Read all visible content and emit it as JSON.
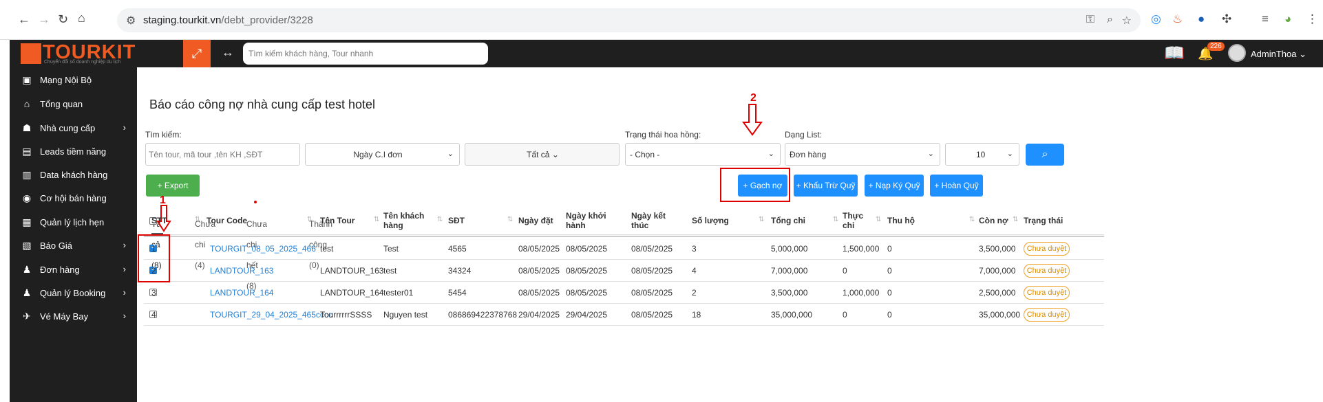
{
  "browser": {
    "url_host": "staging.tourkit.vn",
    "url_path": "/debt_provider/3228"
  },
  "topbar": {
    "logo": "TOURKIT",
    "logo_tagline": "Chuyển đổi số doanh nghiệp du lịch",
    "search_placeholder": "Tìm kiếm khách hàng, Tour nhanh",
    "notification_count": "226",
    "user_name": "AdminThoa ⌄"
  },
  "sidebar": {
    "items": [
      {
        "label": "Mạng Nội Bộ",
        "icon": "briefcase-icon",
        "glyph": "▣",
        "chev": ""
      },
      {
        "label": "Tổng quan",
        "icon": "home-icon",
        "glyph": "⌂",
        "chev": ""
      },
      {
        "label": "Nhà cung cấp",
        "icon": "users-icon",
        "glyph": "☗",
        "chev": "›"
      },
      {
        "label": "Leads tiềm năng",
        "icon": "files-icon",
        "glyph": "▤",
        "chev": ""
      },
      {
        "label": "Data khách hàng",
        "icon": "database-icon",
        "glyph": "▥",
        "chev": ""
      },
      {
        "label": "Cơ hội bán hàng",
        "icon": "target-icon",
        "glyph": "◉",
        "chev": ""
      },
      {
        "label": "Quản lý lịch hẹn",
        "icon": "calendar-icon",
        "glyph": "▦",
        "chev": ""
      },
      {
        "label": "Báo Giá",
        "icon": "quote-icon",
        "glyph": "▧",
        "chev": "›"
      },
      {
        "label": "Đơn hàng",
        "icon": "order-icon",
        "glyph": "♟",
        "chev": "›"
      },
      {
        "label": "Quản lý Booking",
        "icon": "booking-icon",
        "glyph": "♟",
        "chev": "›"
      },
      {
        "label": "Vé Máy Bay",
        "icon": "plane-icon",
        "glyph": "✈",
        "chev": "›"
      }
    ]
  },
  "page": {
    "title": "Báo cáo công nợ nhà cung cấp test hotel"
  },
  "filters": {
    "search_label": "Tìm kiếm:",
    "search_placeholder": "Tên tour, mã tour ,tên KH ,SĐT",
    "date_type": "Ngày C.I đơn",
    "all": "Tất cả",
    "commission_label": "Trạng thái hoa hồng:",
    "commission_value": "- Chọn -",
    "list_type_label": "Dạng List:",
    "list_type_value": "Đơn hàng",
    "page_size": "10"
  },
  "actions": {
    "export": "Export",
    "gach_no": "Gạch nợ",
    "khau_tru_quy": "Khấu Trừ Quỹ",
    "nap_ky_quy": "Nạp Ký Quỹ",
    "hoan_quy": "Hoàn Quỹ"
  },
  "tabs": [
    "Tất cả (8)",
    "Chưa chi (4)",
    "Chưa chi hết (8)",
    "Thành công (0)"
  ],
  "table": {
    "headers": {
      "stt": "STT",
      "tour_code": "Tour Code",
      "ten_tour": "Tên Tour",
      "ten_kh_1": "Tên khách",
      "ten_kh_2": "hàng",
      "sdt": "SĐT",
      "ngay_dat": "Ngày đặt",
      "ngay_khoi_1": "Ngày khởi",
      "ngay_khoi_2": "hành",
      "ngay_ket_1": "Ngày kết",
      "ngay_ket_2": "thúc",
      "so_luong": "Số lượng",
      "tong_chi": "Tổng chi",
      "thuc_chi_1": "Thực",
      "thuc_chi_2": "chi",
      "thu_ho": "Thu hộ",
      "con_no": "Còn nợ",
      "trang_thai": "Trạng thái"
    },
    "rows": [
      {
        "checked": true,
        "stt": "1",
        "tour_code": "TOURGIT_08_05_2025_466",
        "ten_tour": "test",
        "ten_kh": "Test",
        "sdt": "4565",
        "ngay_dat": "08/05/2025",
        "ngay_khoi": "08/05/2025",
        "ngay_ket": "08/05/2025",
        "so_luong": "3",
        "tong_chi": "5,000,000",
        "thuc_chi": "1,500,000",
        "thu_ho": "0",
        "con_no": "3,500,000",
        "status": "Chưa duyệt"
      },
      {
        "checked": true,
        "stt": "2",
        "tour_code": "LANDTOUR_163",
        "ten_tour": "LANDTOUR_163",
        "ten_kh": "test",
        "sdt": "34324",
        "ngay_dat": "08/05/2025",
        "ngay_khoi": "08/05/2025",
        "ngay_ket": "08/05/2025",
        "so_luong": "4",
        "tong_chi": "7,000,000",
        "thuc_chi": "0",
        "thu_ho": "0",
        "con_no": "7,000,000",
        "status": "Chưa duyệt"
      },
      {
        "checked": false,
        "stt": "3",
        "tour_code": "LANDTOUR_164",
        "ten_tour": "LANDTOUR_164",
        "ten_kh": "tester01",
        "sdt": "5454",
        "ngay_dat": "08/05/2025",
        "ngay_khoi": "08/05/2025",
        "ngay_ket": "08/05/2025",
        "so_luong": "2",
        "tong_chi": "3,500,000",
        "thuc_chi": "1,000,000",
        "thu_ho": "0",
        "con_no": "2,500,000",
        "status": "Chưa duyệt"
      },
      {
        "checked": false,
        "stt": "4",
        "tour_code": "TOURGIT_29_04_2025_465cccc",
        "ten_tour": "TourrrrrrSSSS",
        "ten_kh": "Nguyen test",
        "sdt": "086869422378768",
        "ngay_dat": "29/04/2025",
        "ngay_khoi": "29/04/2025",
        "ngay_ket": "08/05/2025",
        "so_luong": "18",
        "tong_chi": "35,000,000",
        "thuc_chi": "0",
        "thu_ho": "0",
        "con_no": "35,000,000",
        "status": "Chưa duyệt"
      }
    ]
  },
  "annotations": {
    "marker_1": "1",
    "marker_2": "2"
  },
  "colors": {
    "brand": "#ef5b22",
    "primary": "#1e90ff",
    "success": "#4cae4c",
    "annotation": "#e00000",
    "sidebar": "#1f1f1f"
  }
}
